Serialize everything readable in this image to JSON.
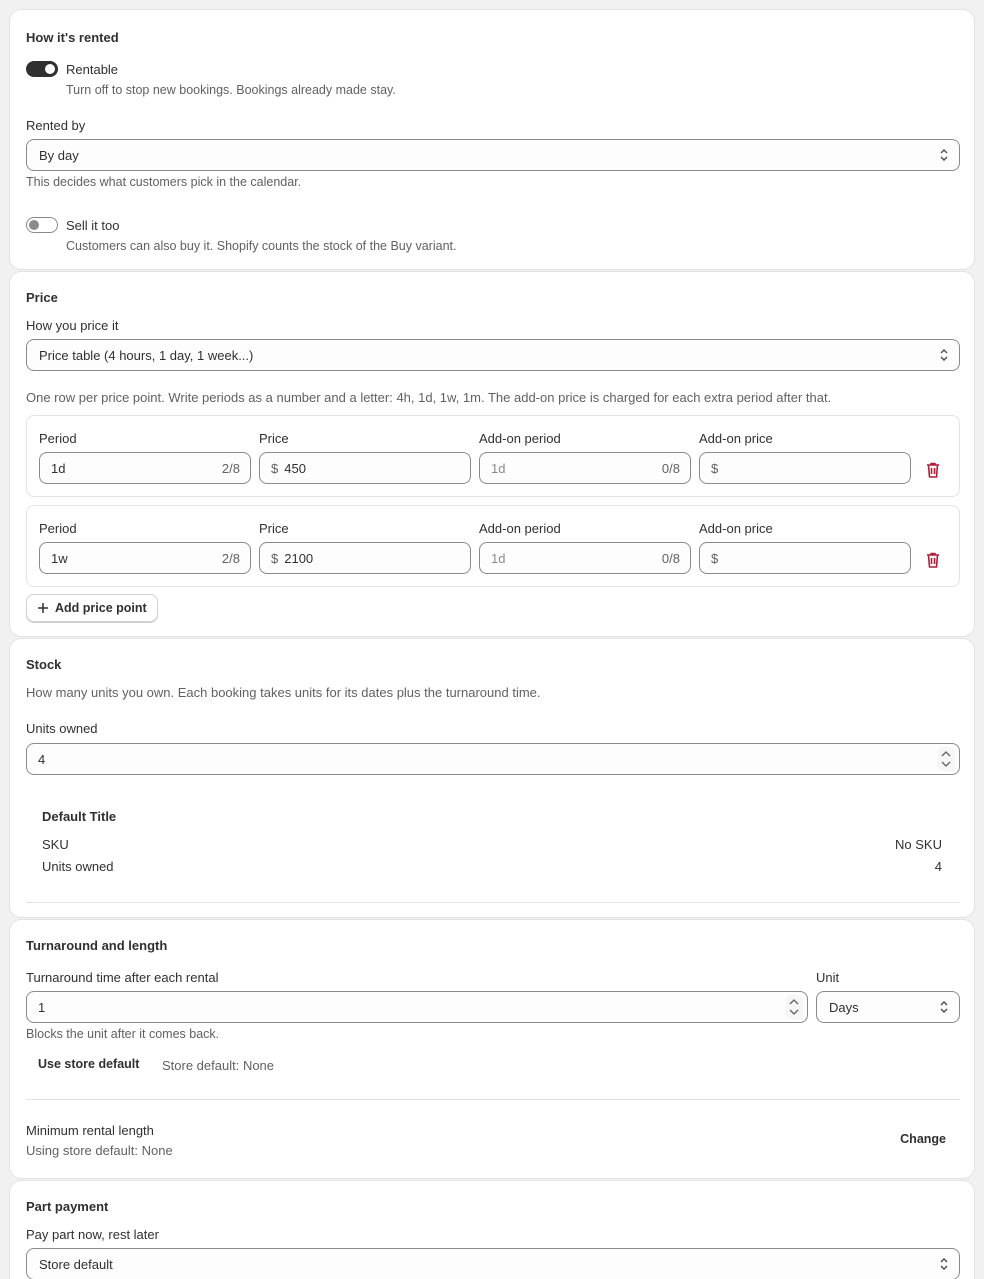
{
  "rental": {
    "title": "How it's rented",
    "rentable_label": "Rentable",
    "rentable_on": true,
    "rentable_help": "Turn off to stop new bookings. Bookings already made stay.",
    "rented_by_label": "Rented by",
    "rented_by_value": "By day",
    "rented_by_help": "This decides what customers pick in the calendar.",
    "sell_label": "Sell it too",
    "sell_on": false,
    "sell_help": "Customers can also buy it. Shopify counts the stock of the Buy variant."
  },
  "price": {
    "title": "Price",
    "method_label": "How you price it",
    "method_value": "Price table (4 hours, 1 day, 1 week...)",
    "help": "One row per price point. Write periods as a number and a letter: 4h, 1d, 1w, 1m. The add-on price is charged for each extra period after that.",
    "columns": {
      "period": "Period",
      "price": "Price",
      "addon_period": "Add-on period",
      "addon_price": "Add-on price"
    },
    "currency": "$",
    "rows": [
      {
        "period": "1d",
        "period_count": "2/8",
        "price": "450",
        "addon_period_placeholder": "1d",
        "addon_count": "0/8"
      },
      {
        "period": "1w",
        "period_count": "2/8",
        "price": "2100",
        "addon_period_placeholder": "1d",
        "addon_count": "0/8"
      }
    ],
    "add_label": "Add price point"
  },
  "stock": {
    "title": "Stock",
    "help": "How many units you own. Each booking takes units for its dates plus the turnaround time.",
    "units_label": "Units owned",
    "units_value": "4",
    "variant_title": "Default Title",
    "sku_label": "SKU",
    "sku_value": "No SKU",
    "variant_units_label": "Units owned",
    "variant_units_value": "4"
  },
  "turnaround": {
    "title": "Turnaround and length",
    "time_label": "Turnaround time after each rental",
    "time_value": "1",
    "unit_label": "Unit",
    "unit_value": "Days",
    "help": "Blocks the unit after it comes back.",
    "use_default_label": "Use store default",
    "store_default_text": "Store default: None",
    "min_label": "Minimum rental length",
    "min_help": "Using store default: None",
    "change_label": "Change"
  },
  "part_payment": {
    "title": "Part payment",
    "label": "Pay part now, rest later",
    "value": "Store default"
  },
  "colors": {
    "toggle_on": "#303030",
    "toggle_off": "#8a8a8a",
    "danger": "#b41c3a"
  }
}
